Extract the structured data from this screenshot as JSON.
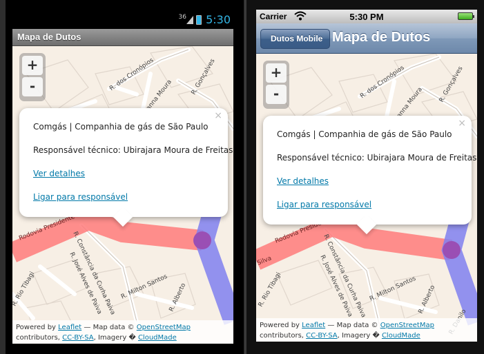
{
  "android": {
    "status": {
      "signal": "36",
      "time": "5:30"
    },
    "title": "Mapa de Dutos"
  },
  "iphone": {
    "status": {
      "carrier": "Carrier",
      "time": "5:30 PM"
    },
    "back_label": "Dutos Mobile",
    "title": "Mapa de Dutos"
  },
  "map": {
    "zoom_in": "+",
    "zoom_out": "-",
    "popup": {
      "close": "×",
      "company": "Comgás | Companhia de gás de São Paulo",
      "technician": "Responsável técnico: Ubirajara Moura de Freitas",
      "details_link": "Ver detalhes",
      "call_link": "Ligar para responsável"
    },
    "attribution": {
      "powered_by": "Powered by",
      "leaflet": "Leaflet",
      "map_data": " — Map data © ",
      "osm": "OpenStreetMap",
      "contributors": "contributors, ",
      "license": "CC-BY-SA",
      "imagery": ", Imagery � ",
      "cloudmade": "CloudMade"
    },
    "labels": {
      "cronopios": "R. dos Cronópios",
      "vianna": "mir Vianna Moura",
      "goncalves": "R. Gonçalves",
      "rodovia": "Rodovia Presidente Dutra",
      "constancia": "R. Constância da Curha Paiva",
      "jose": "R. José Alves de Paiva",
      "milton": "R. Milton Santos",
      "alberto": "R. Alberto",
      "tibagi": "R. Rio Tibagi",
      "danilo": "R. Danilo",
      "silva": "Silva"
    },
    "colors": {
      "red_pipe": "#ff7b7b",
      "blue_pipe": "#8080f0",
      "overlap": "#9a4fb4",
      "link": "#0078a8"
    }
  }
}
